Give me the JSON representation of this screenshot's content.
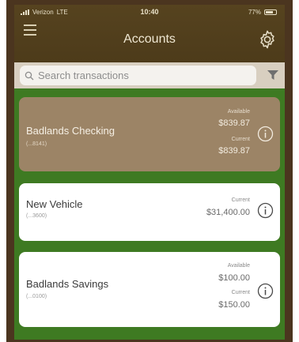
{
  "status_bar": {
    "carrier": "Verizon",
    "network": "LTE",
    "time": "10:40",
    "battery_text": "77%",
    "battery_level": 0.77
  },
  "header": {
    "title": "Accounts",
    "menu_icon": "hamburger-menu-icon",
    "settings_icon": "gear-icon"
  },
  "search": {
    "placeholder": "Search transactions",
    "filter_icon": "funnel-icon"
  },
  "colors": {
    "header_bg": "#56431f",
    "selected_card": "#9c8466",
    "background_green": "#3e7a22"
  },
  "accounts": [
    {
      "name": "Badlands Checking",
      "number": "(...8141)",
      "available_label": "Available",
      "available": "$839.87",
      "current_label": "Current",
      "current": "$839.87",
      "selected": true
    },
    {
      "name": "New Vehicle",
      "number": "(...3600)",
      "current_label": "Current",
      "current": "$31,400.00",
      "selected": false
    },
    {
      "name": "Badlands Savings",
      "number": "(...0100)",
      "available_label": "Available",
      "available": "$100.00",
      "current_label": "Current",
      "current": "$150.00",
      "selected": false
    }
  ]
}
